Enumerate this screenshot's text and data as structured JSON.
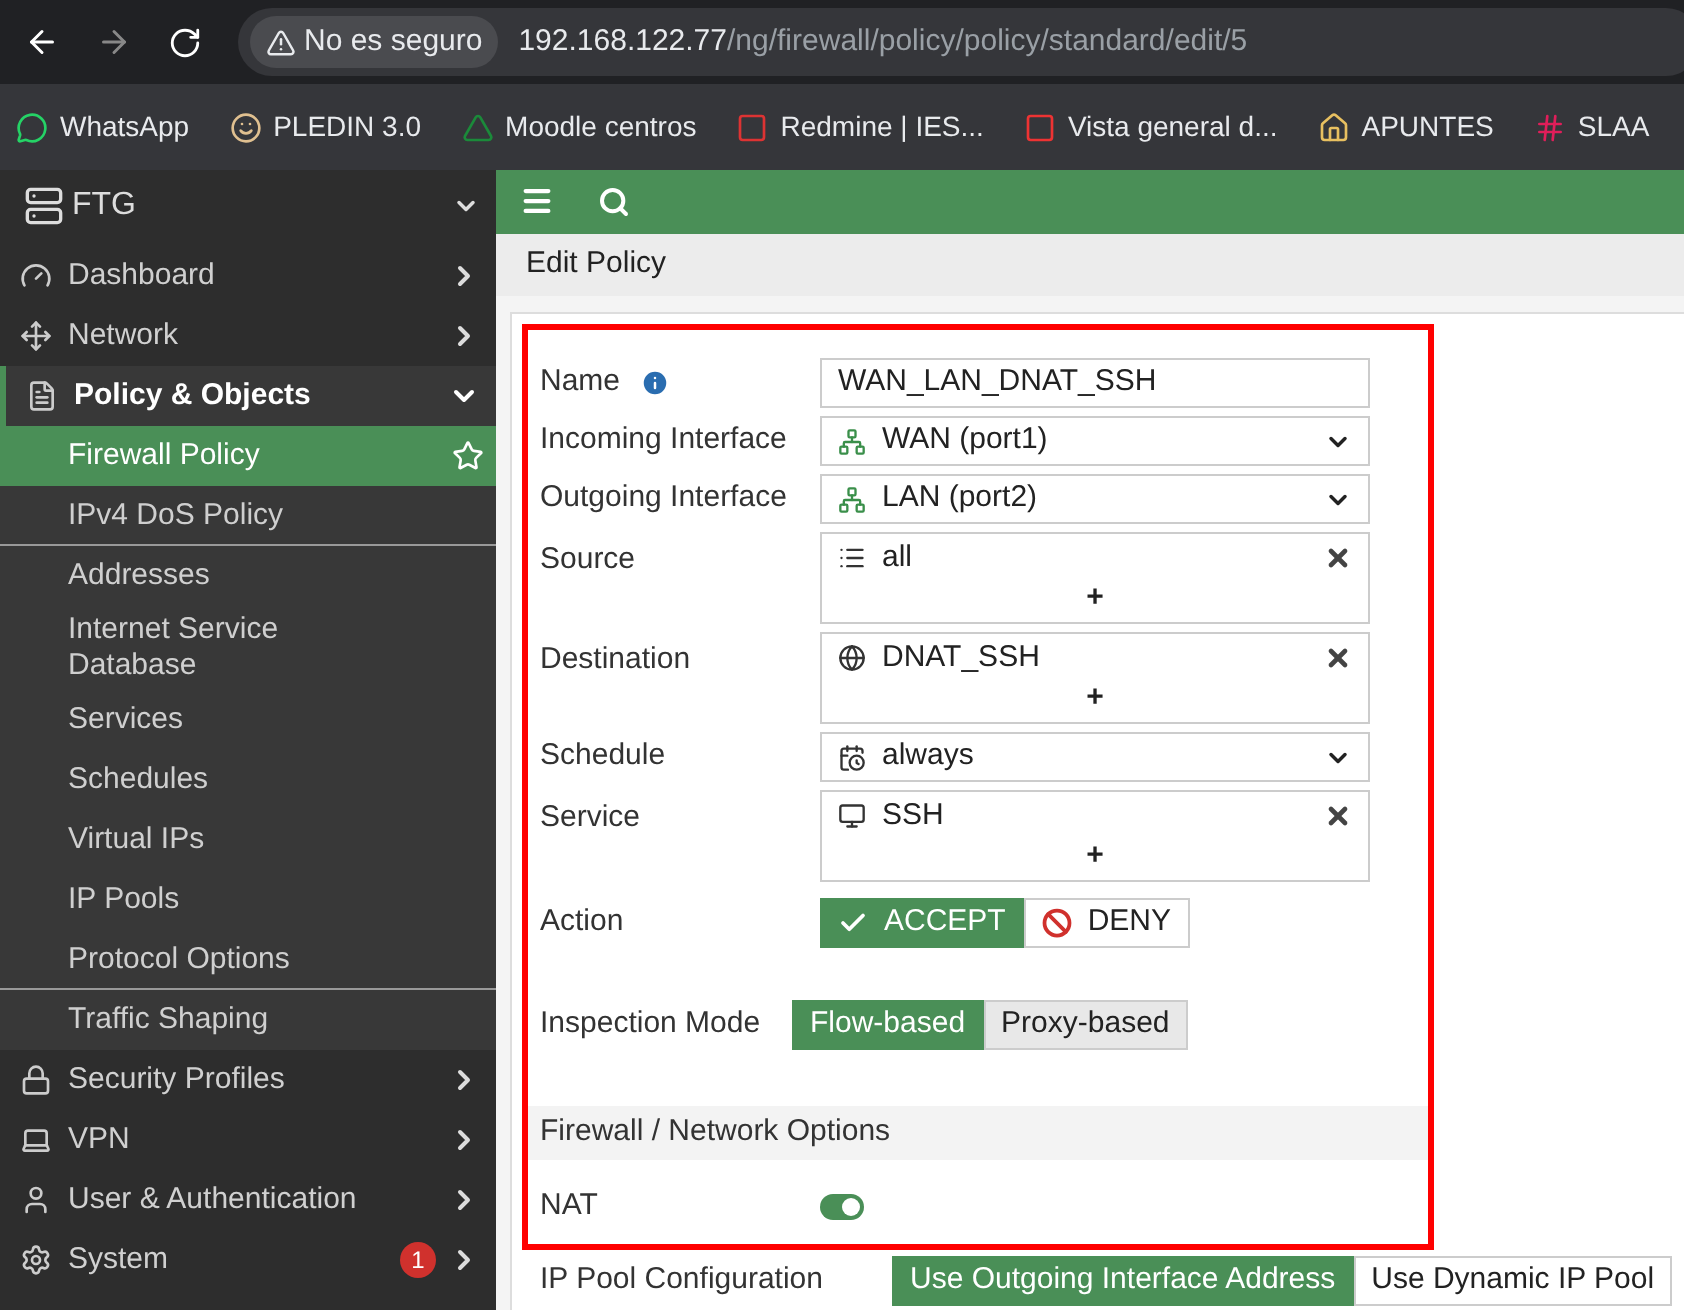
{
  "browser": {
    "security_label": "No es seguro",
    "url_host": "192.168.122.77",
    "url_path": "/ng/firewall/policy/policy/standard/edit/5",
    "bookmarks": [
      {
        "label": "WhatsApp"
      },
      {
        "label": "PLEDIN 3.0"
      },
      {
        "label": "Moodle centros"
      },
      {
        "label": "Redmine | IES..."
      },
      {
        "label": "Vista general d..."
      },
      {
        "label": "APUNTES"
      },
      {
        "label": "SLAA"
      }
    ]
  },
  "sidebar": {
    "device": "FTG",
    "items": [
      {
        "label": "Dashboard",
        "expanded": false
      },
      {
        "label": "Network",
        "expanded": false
      },
      {
        "label": "Policy & Objects",
        "expanded": true,
        "children": [
          {
            "label": "Firewall Policy",
            "selected": true,
            "divider_below": false
          },
          {
            "label": "IPv4 DoS Policy",
            "selected": false,
            "divider_below": true
          },
          {
            "label": "Addresses",
            "selected": false,
            "divider_below": false
          },
          {
            "label": "Internet Service Database",
            "selected": false,
            "divider_below": false
          },
          {
            "label": "Services",
            "selected": false,
            "divider_below": false
          },
          {
            "label": "Schedules",
            "selected": false,
            "divider_below": false
          },
          {
            "label": "Virtual IPs",
            "selected": false,
            "divider_below": false
          },
          {
            "label": "IP Pools",
            "selected": false,
            "divider_below": false
          },
          {
            "label": "Protocol Options",
            "selected": false,
            "divider_below": true
          },
          {
            "label": "Traffic Shaping",
            "selected": false,
            "divider_below": false
          }
        ]
      },
      {
        "label": "Security Profiles",
        "expanded": false
      },
      {
        "label": "VPN",
        "expanded": false
      },
      {
        "label": "User & Authentication",
        "expanded": false
      },
      {
        "label": "System",
        "expanded": false,
        "badge": "1"
      }
    ]
  },
  "page_title": "Edit Policy",
  "form": {
    "fields": [
      {
        "kind": "text",
        "label": "Name",
        "info": true,
        "value": "WAN_LAN_DNAT_SSH"
      },
      {
        "kind": "select",
        "label": "Incoming Interface",
        "value": "WAN (port1)"
      },
      {
        "kind": "select",
        "label": "Outgoing Interface",
        "value": "LAN (port2)"
      },
      {
        "kind": "multi",
        "label": "Source",
        "value": "all",
        "add": "+"
      },
      {
        "kind": "multi",
        "label": "Destination",
        "value": "DNAT_SSH",
        "add": "+"
      },
      {
        "kind": "select",
        "label": "Schedule",
        "value": "always"
      },
      {
        "kind": "multi",
        "label": "Service",
        "value": "SSH",
        "add": "+"
      }
    ],
    "action": {
      "label": "Action",
      "options": [
        {
          "label": "ACCEPT",
          "selected": true
        },
        {
          "label": "DENY",
          "selected": false
        }
      ]
    },
    "inspection": {
      "label": "Inspection Mode",
      "options": [
        {
          "label": "Flow-based",
          "selected": true
        },
        {
          "label": "Proxy-based",
          "selected": false
        }
      ]
    },
    "section": "Firewall / Network Options",
    "nat": {
      "label": "NAT",
      "on": true
    },
    "ip_pool": {
      "label": "IP Pool Configuration",
      "options": [
        {
          "label": "Use Outgoing Interface Address",
          "selected": true
        },
        {
          "label": "Use Dynamic IP Pool",
          "selected": false
        }
      ]
    }
  }
}
